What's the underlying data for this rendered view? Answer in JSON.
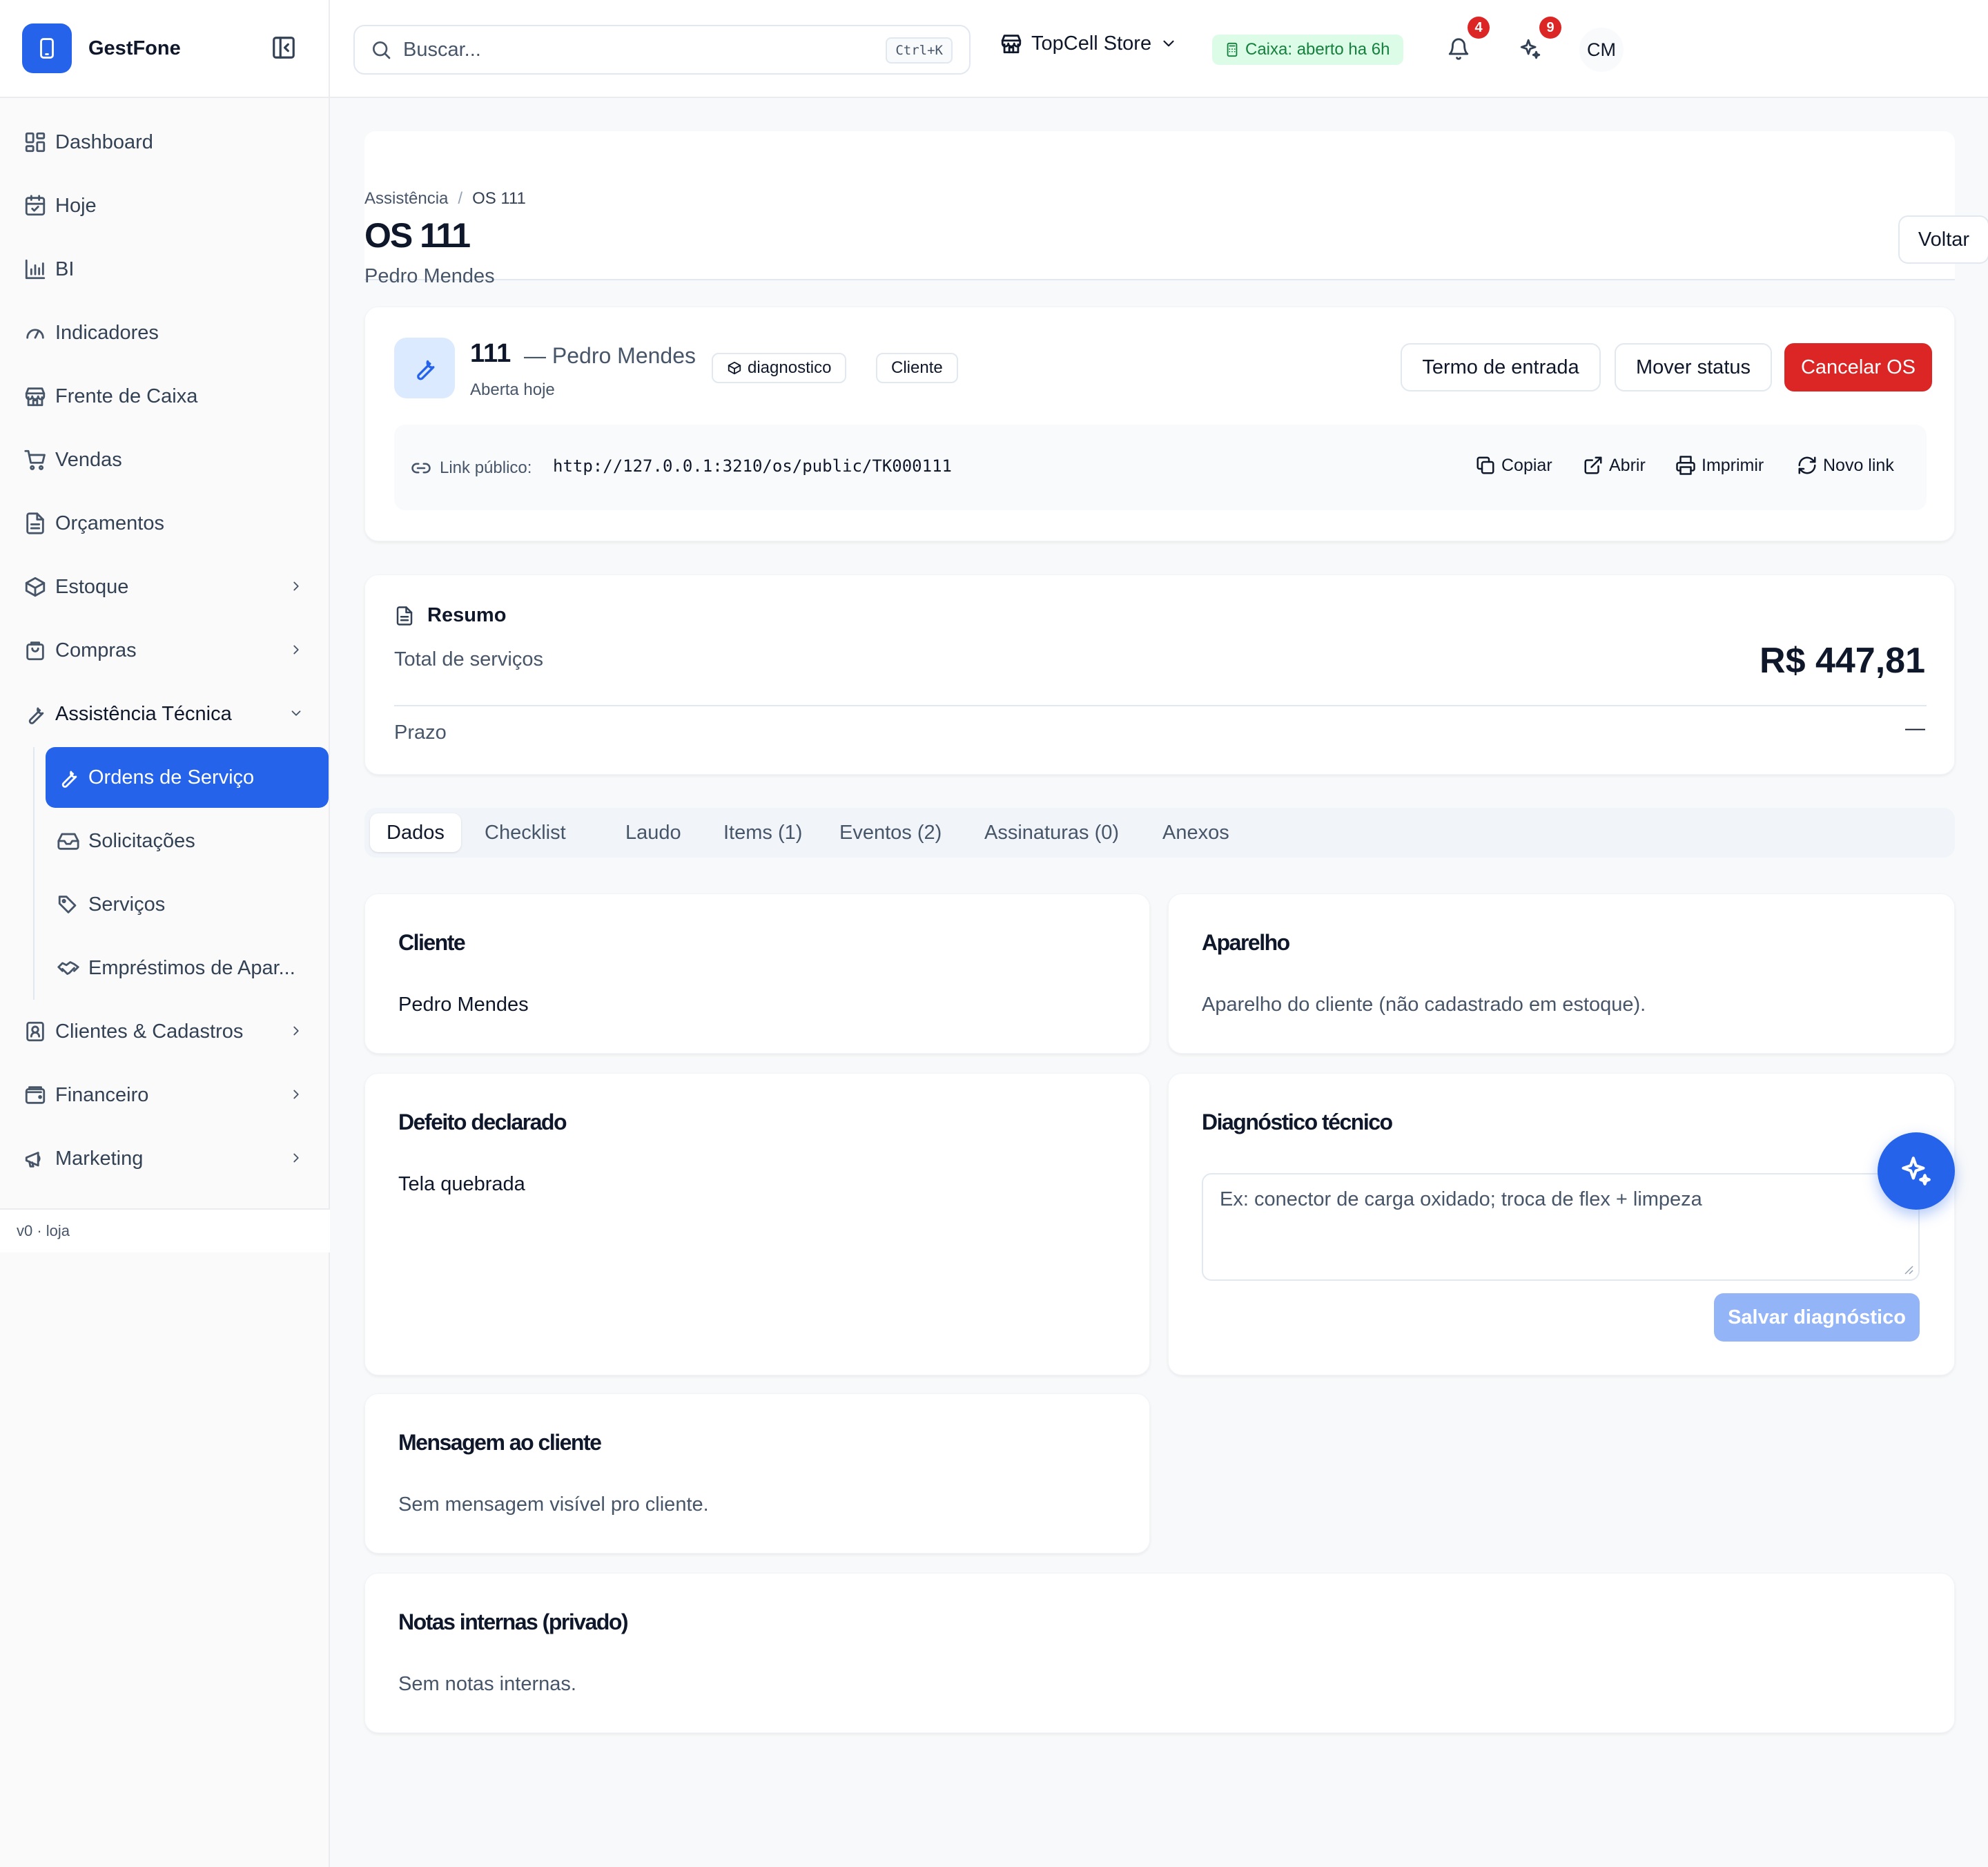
{
  "app": {
    "name": "GestFone",
    "version": "v0 · loja"
  },
  "sidebar": {
    "items": [
      {
        "label": "Dashboard",
        "icon": "dashboard-icon"
      },
      {
        "label": "Hoje",
        "icon": "calendar-icon"
      },
      {
        "label": "BI",
        "icon": "bar-chart-icon"
      },
      {
        "label": "Indicadores",
        "icon": "gauge-icon"
      },
      {
        "label": "Frente de Caixa",
        "icon": "store-icon"
      },
      {
        "label": "Vendas",
        "icon": "cart-icon"
      },
      {
        "label": "Orçamentos",
        "icon": "document-icon"
      },
      {
        "label": "Estoque",
        "icon": "package-icon"
      },
      {
        "label": "Compras",
        "icon": "shopping-bag-icon"
      },
      {
        "label": "Assistência Técnica",
        "icon": "wrench-icon"
      },
      {
        "label": "Clientes & Cadastros",
        "icon": "contact-icon"
      },
      {
        "label": "Financeiro",
        "icon": "wallet-icon"
      },
      {
        "label": "Marketing",
        "icon": "megaphone-icon"
      }
    ],
    "sub_items": [
      {
        "label": "Ordens de Serviço",
        "icon": "wrench-icon"
      },
      {
        "label": "Solicitações",
        "icon": "inbox-icon"
      },
      {
        "label": "Serviços",
        "icon": "tags-icon"
      },
      {
        "label": "Empréstimos de Apar...",
        "icon": "handshake-icon"
      }
    ]
  },
  "topbar": {
    "search_placeholder": "Buscar...",
    "shortcut": "Ctrl+K",
    "store": "TopCell Store",
    "caixa_status": "Caixa: aberto ha 6h",
    "notifications_count": "4",
    "ai_count": "9",
    "user_initials": "CM"
  },
  "page": {
    "breadcrumb": [
      "Assistência",
      "/",
      "OS 111"
    ],
    "title": "OS 111",
    "subtitle": "Pedro Mendes",
    "back_label": "Voltar"
  },
  "os": {
    "number": "111",
    "client_dash": "— Pedro Mendes",
    "opened": "Aberta hoje",
    "status_chip": "diagnostico",
    "origin_chip": "Cliente",
    "actions": [
      "Termo de entrada",
      "Mover status",
      "Cancelar OS"
    ],
    "link_label": "Link público:",
    "link_url": "http://127.0.0.1:3210/os/public/TK000111",
    "link_actions": [
      "Copiar",
      "Abrir",
      "Imprimir",
      "Novo link"
    ]
  },
  "summary": {
    "title": "Resumo",
    "total_label": "Total de serviços",
    "total_value": "R$ 447,81",
    "deadline_label": "Prazo",
    "deadline_value": "—"
  },
  "tabs": [
    "Dados",
    "Checklist",
    "Laudo",
    "Items (1)",
    "Eventos (2)",
    "Assinaturas (0)",
    "Anexos"
  ],
  "cards": {
    "cliente": {
      "title": "Cliente",
      "text": "Pedro Mendes"
    },
    "aparelho": {
      "title": "Aparelho",
      "text": "Aparelho do cliente (não cadastrado em estoque)."
    },
    "defeito": {
      "title": "Defeito declarado",
      "text": "Tela quebrada"
    },
    "diagnostico": {
      "title": "Diagnóstico técnico",
      "placeholder": "Ex: conector de carga oxidado; troca de flex + limpeza",
      "save_label": "Salvar diagnóstico"
    },
    "mensagem": {
      "title": "Mensagem ao cliente",
      "text": "Sem mensagem visível pro cliente."
    },
    "notas": {
      "title": "Notas internas (privado)",
      "text": "Sem notas internas."
    }
  },
  "colors": {
    "primary": "#2563eb",
    "danger": "#dc2626",
    "success_bg": "#dcfce7",
    "success_text": "#15803d"
  }
}
